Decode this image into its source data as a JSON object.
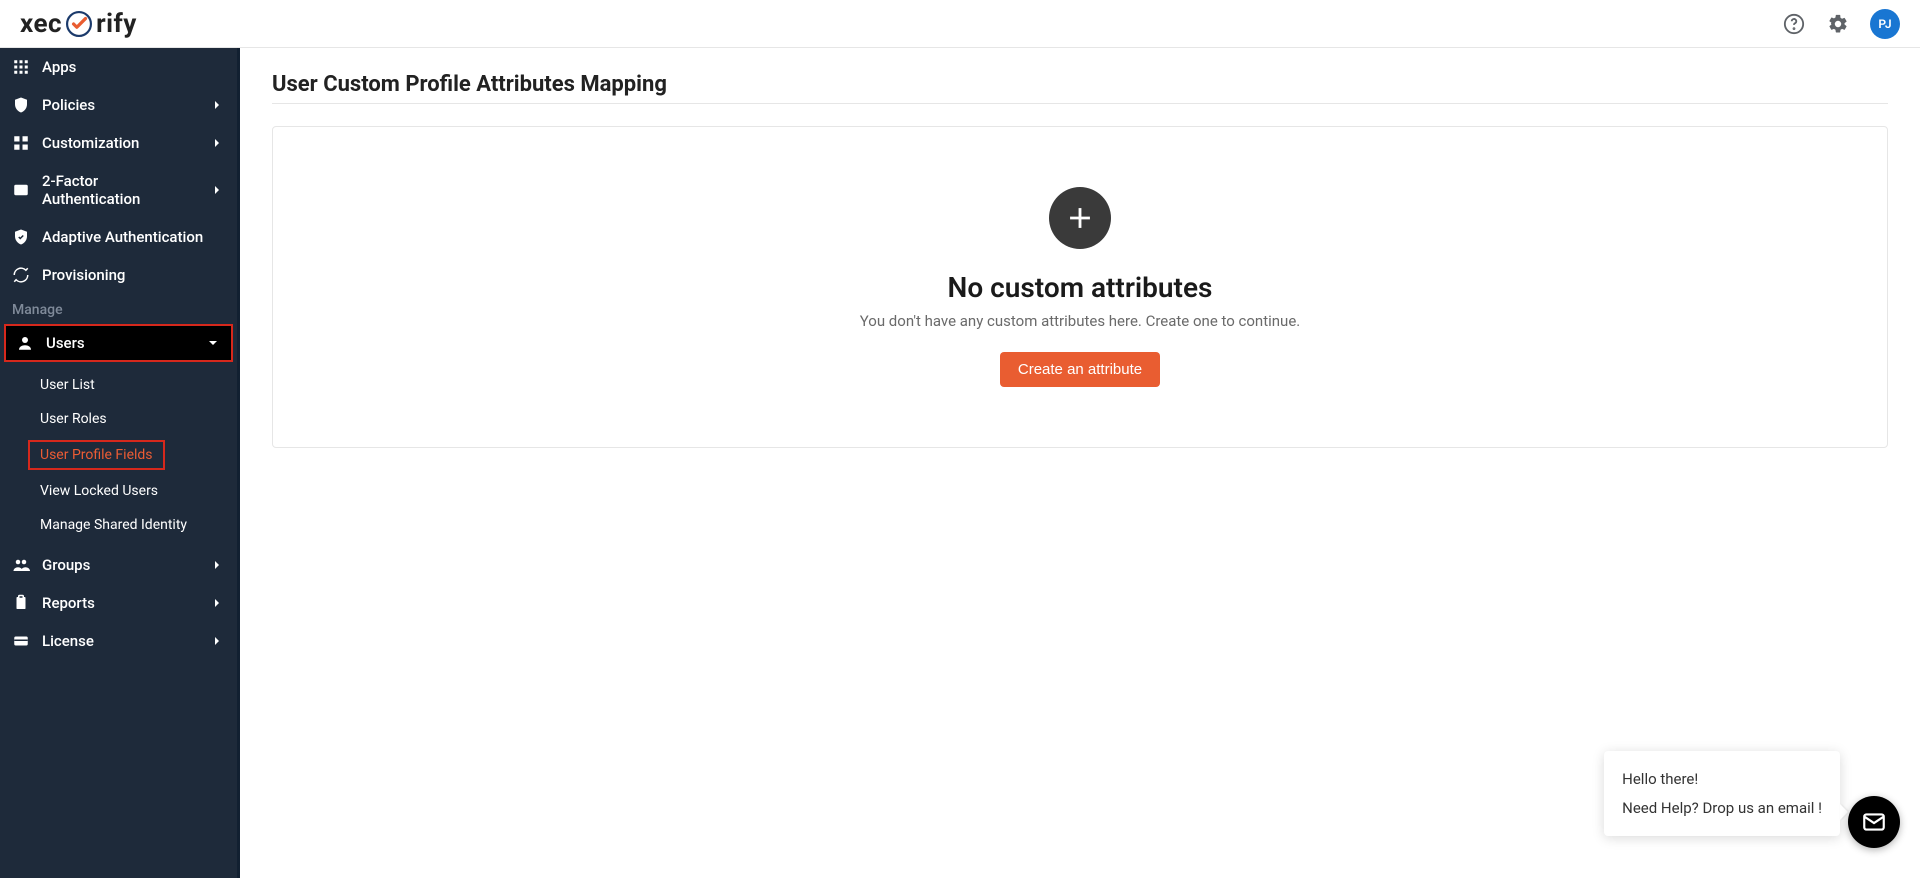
{
  "brand": {
    "part1": "xec",
    "part2": "rify"
  },
  "header": {
    "avatar_initials": "PJ"
  },
  "sidebar": {
    "apps_label": "Apps",
    "policies_label": "Policies",
    "customization_label": "Customization",
    "twofa_label": "2-Factor Authentication",
    "adaptive_label": "Adaptive Authentication",
    "provisioning_label": "Provisioning",
    "manage_section": "Manage",
    "users_label": "Users",
    "users_sub": {
      "user_list": "User List",
      "user_roles": "User Roles",
      "user_profile_fields": "User Profile Fields",
      "view_locked_users": "View Locked Users",
      "manage_shared_identity": "Manage Shared Identity"
    },
    "groups_label": "Groups",
    "reports_label": "Reports",
    "license_label": "License"
  },
  "page": {
    "title": "User Custom Profile Attributes Mapping",
    "empty_title": "No custom attributes",
    "empty_sub": "You don't have any custom attributes here. Create one to continue.",
    "create_button": "Create an attribute"
  },
  "chat": {
    "line1": "Hello there!",
    "line2": "Need Help? Drop us an email !"
  }
}
